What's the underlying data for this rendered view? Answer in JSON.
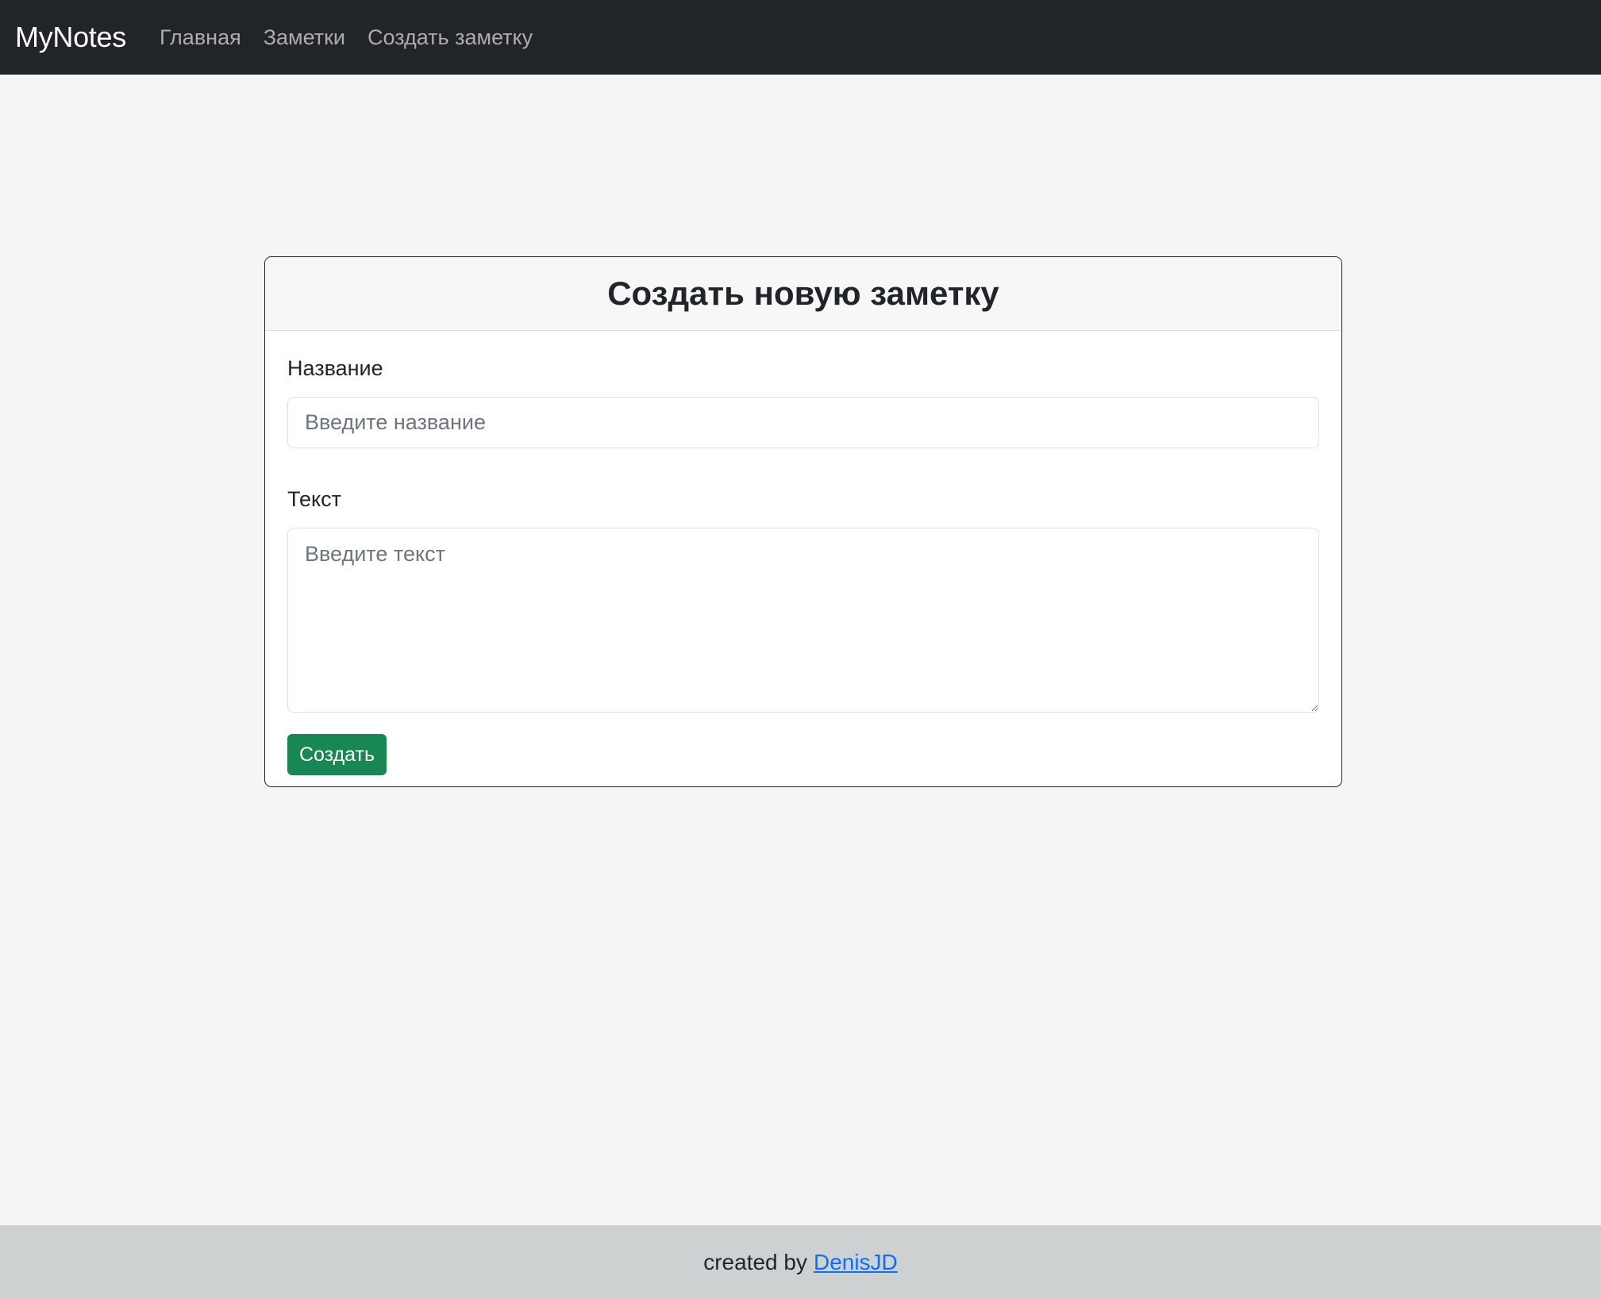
{
  "navbar": {
    "brand": "MyNotes",
    "links": [
      {
        "label": "Главная"
      },
      {
        "label": "Заметки"
      },
      {
        "label": "Создать заметку"
      }
    ]
  },
  "card": {
    "title": "Создать новую заметку",
    "title_field": {
      "label": "Название",
      "placeholder": "Введите название",
      "value": ""
    },
    "text_field": {
      "label": "Текст",
      "placeholder": "Введите текст",
      "value": ""
    },
    "submit_label": "Создать"
  },
  "footer": {
    "prefix": "created by",
    "author": "DenisJD"
  },
  "colors": {
    "navbar_bg": "#212529",
    "page_bg": "#f4f5f4",
    "button_bg": "#198754",
    "link": "#0d6efd",
    "footer_bg": "#cdd1d2"
  }
}
